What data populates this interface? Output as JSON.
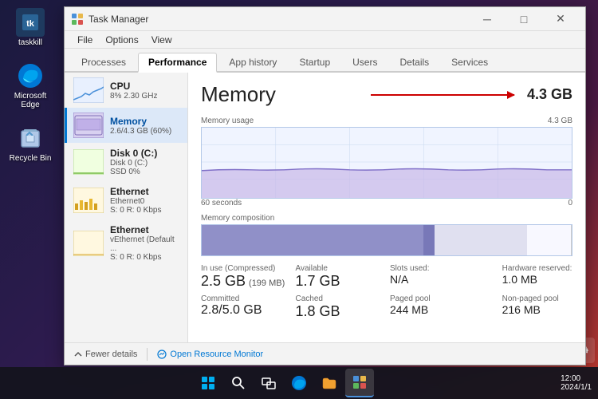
{
  "desktop": {
    "icons": [
      {
        "name": "taskkill",
        "label": "taskkill",
        "color": "#2a6496"
      },
      {
        "name": "Microsoft Edge",
        "label": "Microsoft Edge",
        "color": "#0078d4"
      },
      {
        "name": "Recycle Bin",
        "label": "Recycle Bin",
        "color": "#5599cc"
      }
    ]
  },
  "taskmanager": {
    "title": "Task Manager",
    "menus": [
      "File",
      "Options",
      "View"
    ],
    "tabs": [
      "Processes",
      "Performance",
      "App history",
      "Startup",
      "Users",
      "Details",
      "Services"
    ],
    "active_tab": "Performance"
  },
  "sidebar": {
    "items": [
      {
        "id": "cpu",
        "name": "CPU",
        "detail": "8% 2.30 GHz",
        "active": false
      },
      {
        "id": "memory",
        "name": "Memory",
        "detail": "2.6/4.3 GB (60%)",
        "active": true
      },
      {
        "id": "disk",
        "name": "Disk 0 (C:)",
        "detail": "SSD\n0%",
        "active": false
      },
      {
        "id": "ethernet0",
        "name": "Ethernet",
        "detail": "Ethernet0\nS: 0  R: 0 Kbps",
        "active": false
      },
      {
        "id": "ethernet1",
        "name": "Ethernet",
        "detail": "vEthernet (Default ...\nS: 0  R: 0 Kbps",
        "active": false
      }
    ]
  },
  "memory_panel": {
    "title": "Memory",
    "total": "4.3 GB",
    "chart_label": "Memory usage",
    "chart_max": "4.3 GB",
    "chart_min": "0",
    "time_label": "60 seconds",
    "composition_label": "Memory composition",
    "stats": {
      "in_use_label": "In use (Compressed)",
      "in_use_value": "2.5 GB",
      "in_use_sub": "(199 MB)",
      "available_label": "Available",
      "available_value": "1.7 GB",
      "slots_label": "Slots used:",
      "slots_value": "N/A",
      "hardware_label": "Hardware reserved:",
      "hardware_value": "1.0 MB",
      "committed_label": "Committed",
      "committed_value": "2.8/5.0 GB",
      "cached_label": "Cached",
      "cached_value": "1.8 GB",
      "paged_label": "Paged pool",
      "paged_value": "244 MB",
      "nonpaged_label": "Non-paged pool",
      "nonpaged_value": "216 MB"
    }
  },
  "footer": {
    "fewer_details": "Fewer details",
    "open_monitor": "Open Resource Monitor"
  }
}
